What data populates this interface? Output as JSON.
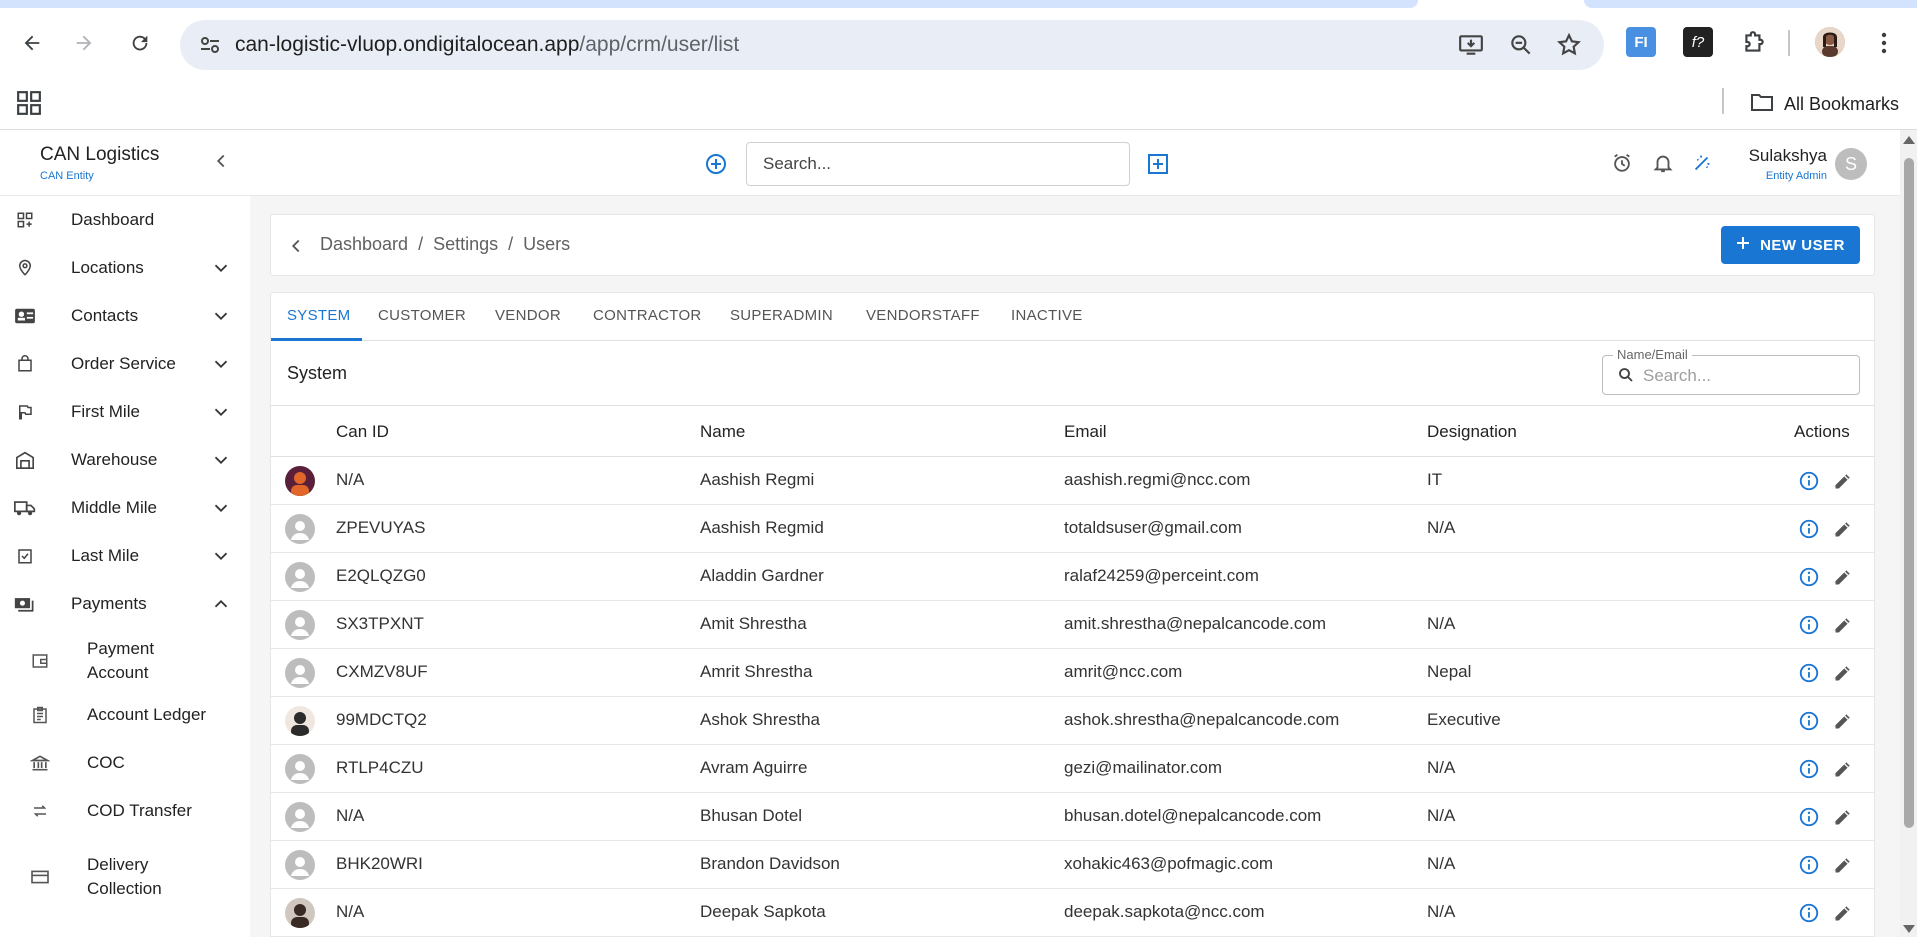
{
  "browser": {
    "url_host": "can-logistic-vluop.ondigitalocean.app",
    "url_path": "/app/crm/user/list",
    "all_bookmarks": "All Bookmarks"
  },
  "app": {
    "brand_name": "CAN Logistics",
    "brand_sub": "CAN Entity",
    "search_placeholder": "Search...",
    "user_name": "Sulakshya",
    "user_role": "Entity Admin",
    "user_initial": "S"
  },
  "sidebar": {
    "items": [
      {
        "label": "Dashboard",
        "icon": "dashboard-icon"
      },
      {
        "label": "Locations",
        "icon": "location-pin-icon"
      },
      {
        "label": "Contacts",
        "icon": "contact-card-icon"
      },
      {
        "label": "Order Service",
        "icon": "shopping-bag-icon"
      },
      {
        "label": "First Mile",
        "icon": "flag-icon"
      },
      {
        "label": "Warehouse",
        "icon": "warehouse-icon"
      },
      {
        "label": "Middle Mile",
        "icon": "truck-icon"
      },
      {
        "label": "Last Mile",
        "icon": "checklist-icon"
      },
      {
        "label": "Payments",
        "icon": "payments-icon"
      }
    ],
    "sub_items": [
      {
        "label": "Payment Account",
        "icon": "wallet-icon"
      },
      {
        "label": "Account Ledger",
        "icon": "ledger-icon"
      },
      {
        "label": "COC",
        "icon": "bank-icon"
      },
      {
        "label": "COD Transfer",
        "icon": "transfer-icon"
      },
      {
        "label": "Delivery Collection",
        "icon": "card-icon"
      }
    ]
  },
  "breadcrumb": [
    "Dashboard",
    "/",
    "Settings",
    "/",
    "Users"
  ],
  "new_user_label": "NEW USER",
  "tabs": [
    "SYSTEM",
    "CUSTOMER",
    "VENDOR",
    "CONTRACTOR",
    "SUPERADMIN",
    "VENDORSTAFF",
    "INACTIVE"
  ],
  "section_title": "System",
  "filter": {
    "label": "Name/Email",
    "placeholder": "Search..."
  },
  "table": {
    "columns": [
      "Can ID",
      "Name",
      "Email",
      "Designation",
      "Actions"
    ],
    "rows": [
      {
        "can_id": "N/A",
        "name": "Aashish Regmi",
        "email": "aashish.regmi@ncc.com",
        "designation": "IT",
        "avatar": "photo"
      },
      {
        "can_id": "ZPEVUYAS",
        "name": "Aashish Regmid",
        "email": "totaldsuser@gmail.com",
        "designation": "N/A",
        "avatar": "default"
      },
      {
        "can_id": "E2QLQZG0",
        "name": "Aladdin Gardner",
        "email": "ralaf24259@perceint.com",
        "designation": "",
        "avatar": "default"
      },
      {
        "can_id": "SX3TPXNT",
        "name": "Amit Shrestha",
        "email": "amit.shrestha@nepalcancode.com",
        "designation": "N/A",
        "avatar": "default"
      },
      {
        "can_id": "CXMZV8UF",
        "name": "Amrit Shrestha",
        "email": "amrit@ncc.com",
        "designation": "Nepal",
        "avatar": "default"
      },
      {
        "can_id": "99MDCTQ2",
        "name": "Ashok Shrestha",
        "email": "ashok.shrestha@nepalcancode.com",
        "designation": "Executive",
        "avatar": "photo"
      },
      {
        "can_id": "RTLP4CZU",
        "name": "Avram Aguirre",
        "email": "gezi@mailinator.com",
        "designation": "N/A",
        "avatar": "default"
      },
      {
        "can_id": "N/A",
        "name": "Bhusan Dotel",
        "email": "bhusan.dotel@nepalcancode.com",
        "designation": "N/A",
        "avatar": "default"
      },
      {
        "can_id": "BHK20WRI",
        "name": "Brandon Davidson",
        "email": "xohakic463@pofmagic.com",
        "designation": "N/A",
        "avatar": "default"
      },
      {
        "can_id": "N/A",
        "name": "Deepak Sapkota",
        "email": "deepak.sapkota@ncc.com",
        "designation": "N/A",
        "avatar": "photo"
      }
    ]
  },
  "colors": {
    "accent": "#1976d2",
    "background": "#f5f5f5"
  }
}
